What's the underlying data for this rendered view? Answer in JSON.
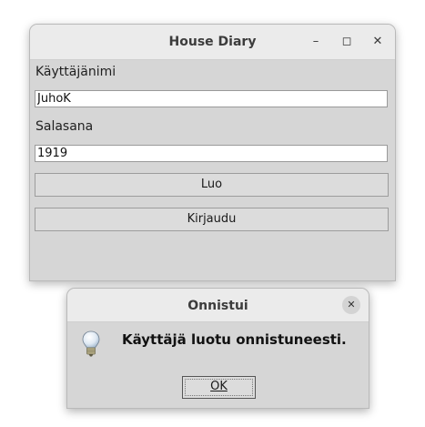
{
  "main_window": {
    "title": "House Diary",
    "controls": {
      "minimize": "–",
      "maximize": "◻",
      "close": "✕"
    },
    "username_label": "Käyttäjänimi",
    "username_value": "JuhoK",
    "password_label": "Salasana",
    "password_value": "1919",
    "create_button": "Luo",
    "login_button": "Kirjaudu"
  },
  "dialog": {
    "title": "Onnistui",
    "close": "✕",
    "message": "Käyttäjä luotu onnistuneesti.",
    "icon": "lightbulb-icon",
    "ok_button": "OK"
  },
  "colors": {
    "window_bg": "#d6d6d6",
    "titlebar_bg": "#ebebeb",
    "field_bg": "#ffffff"
  }
}
